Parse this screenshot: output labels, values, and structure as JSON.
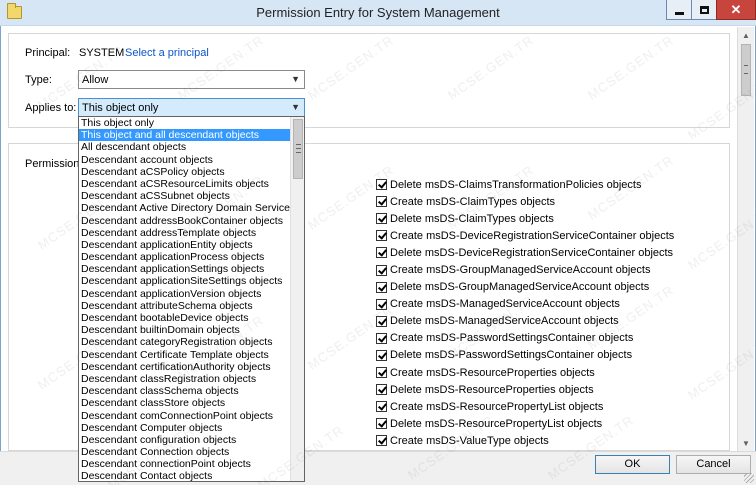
{
  "window": {
    "title": "Permission Entry for System Management"
  },
  "principal": {
    "label": "Principal:",
    "value": "SYSTEM",
    "link": "Select a principal"
  },
  "type": {
    "label": "Type:",
    "value": "Allow"
  },
  "applies_to": {
    "label": "Applies to:",
    "value": "This object only",
    "options": [
      "This object only",
      "This object and all descendant objects",
      "All descendant objects",
      "Descendant account objects",
      "Descendant aCSPolicy objects",
      "Descendant aCSResourceLimits objects",
      "Descendant aCSSubnet objects",
      "Descendant Active Directory Domain Services obj",
      "Descendant addressBookContainer objects",
      "Descendant addressTemplate objects",
      "Descendant applicationEntity objects",
      "Descendant applicationProcess objects",
      "Descendant applicationSettings objects",
      "Descendant applicationSiteSettings objects",
      "Descendant applicationVersion objects",
      "Descendant attributeSchema objects",
      "Descendant bootableDevice objects",
      "Descendant builtinDomain objects",
      "Descendant categoryRegistration objects",
      "Descendant Certificate Template objects",
      "Descendant certificationAuthority objects",
      "Descendant classRegistration objects",
      "Descendant classSchema objects",
      "Descendant classStore objects",
      "Descendant comConnectionPoint objects",
      "Descendant Computer objects",
      "Descendant configuration objects",
      "Descendant Connection objects",
      "Descendant connectionPoint objects",
      "Descendant Contact objects"
    ],
    "selected_index": 1
  },
  "permissions": {
    "label": "Permissions:",
    "items": [
      "Delete msDS-ClaimsTransformationPolicies objects",
      "Create msDS-ClaimTypes objects",
      "Delete msDS-ClaimTypes objects",
      "Create msDS-DeviceRegistrationServiceContainer objects",
      "Delete msDS-DeviceRegistrationServiceContainer objects",
      "Create msDS-GroupManagedServiceAccount objects",
      "Delete msDS-GroupManagedServiceAccount objects",
      "Create msDS-ManagedServiceAccount objects",
      "Delete msDS-ManagedServiceAccount objects",
      "Create msDS-PasswordSettingsContainer objects",
      "Delete msDS-PasswordSettingsContainer objects",
      "Create msDS-ResourceProperties objects",
      "Delete msDS-ResourceProperties objects",
      "Create msDS-ResourcePropertyList objects",
      "Delete msDS-ResourcePropertyList objects",
      "Create msDS-ValueType objects"
    ]
  },
  "buttons": {
    "ok": "OK",
    "cancel": "Cancel"
  },
  "watermark": "MCSE.GEN.TR"
}
